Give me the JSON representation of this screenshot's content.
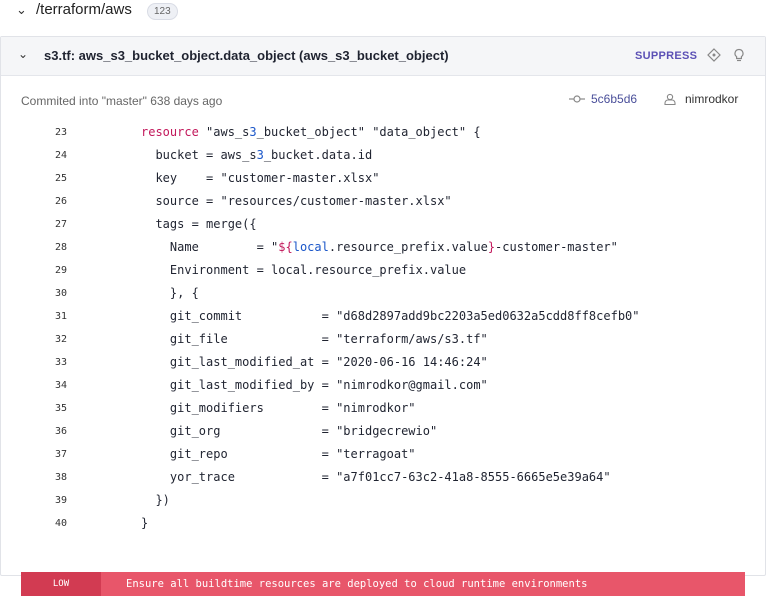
{
  "header": {
    "path": "/terraform/aws",
    "count": "123"
  },
  "panel": {
    "title": "s3.tf: aws_s3_bucket_object.data_object (aws_s3_bucket_object)",
    "suppress_label": "SUPPRESS",
    "meta": "Commited into \"master\" 638 days ago",
    "commit_hash": "5c6b5d6",
    "author": "nimrodkor"
  },
  "code": [
    {
      "n": "23",
      "t": "resource \"aws_s3_bucket_object\" \"data_object\" {"
    },
    {
      "n": "24",
      "t": "  bucket = aws_s3_bucket.data.id"
    },
    {
      "n": "25",
      "t": "  key    = \"customer-master.xlsx\""
    },
    {
      "n": "26",
      "t": "  source = \"resources/customer-master.xlsx\""
    },
    {
      "n": "27",
      "t": "  tags = merge({"
    },
    {
      "n": "28",
      "t": "    Name        = \"${local.resource_prefix.value}-customer-master\""
    },
    {
      "n": "29",
      "t": "    Environment = local.resource_prefix.value"
    },
    {
      "n": "30",
      "t": "    }, {"
    },
    {
      "n": "31",
      "t": "    git_commit           = \"d68d2897add9bc2203a5ed0632a5cdd8ff8cefb0\""
    },
    {
      "n": "32",
      "t": "    git_file             = \"terraform/aws/s3.tf\""
    },
    {
      "n": "33",
      "t": "    git_last_modified_at = \"2020-06-16 14:46:24\""
    },
    {
      "n": "34",
      "t": "    git_last_modified_by = \"nimrodkor@gmail.com\""
    },
    {
      "n": "35",
      "t": "    git_modifiers        = \"nimrodkor\""
    },
    {
      "n": "36",
      "t": "    git_org              = \"bridgecrewio\""
    },
    {
      "n": "37",
      "t": "    git_repo             = \"terragoat\""
    },
    {
      "n": "38",
      "t": "    yor_trace            = \"a7f01cc7-63c2-41a8-8555-6665e5e39a64\""
    },
    {
      "n": "39",
      "t": "  })"
    },
    {
      "n": "40",
      "t": "}"
    }
  ],
  "alert": {
    "severity": "LOW",
    "message": "Ensure all buildtime resources are deployed to cloud runtime environments",
    "color": "#e8566a"
  }
}
